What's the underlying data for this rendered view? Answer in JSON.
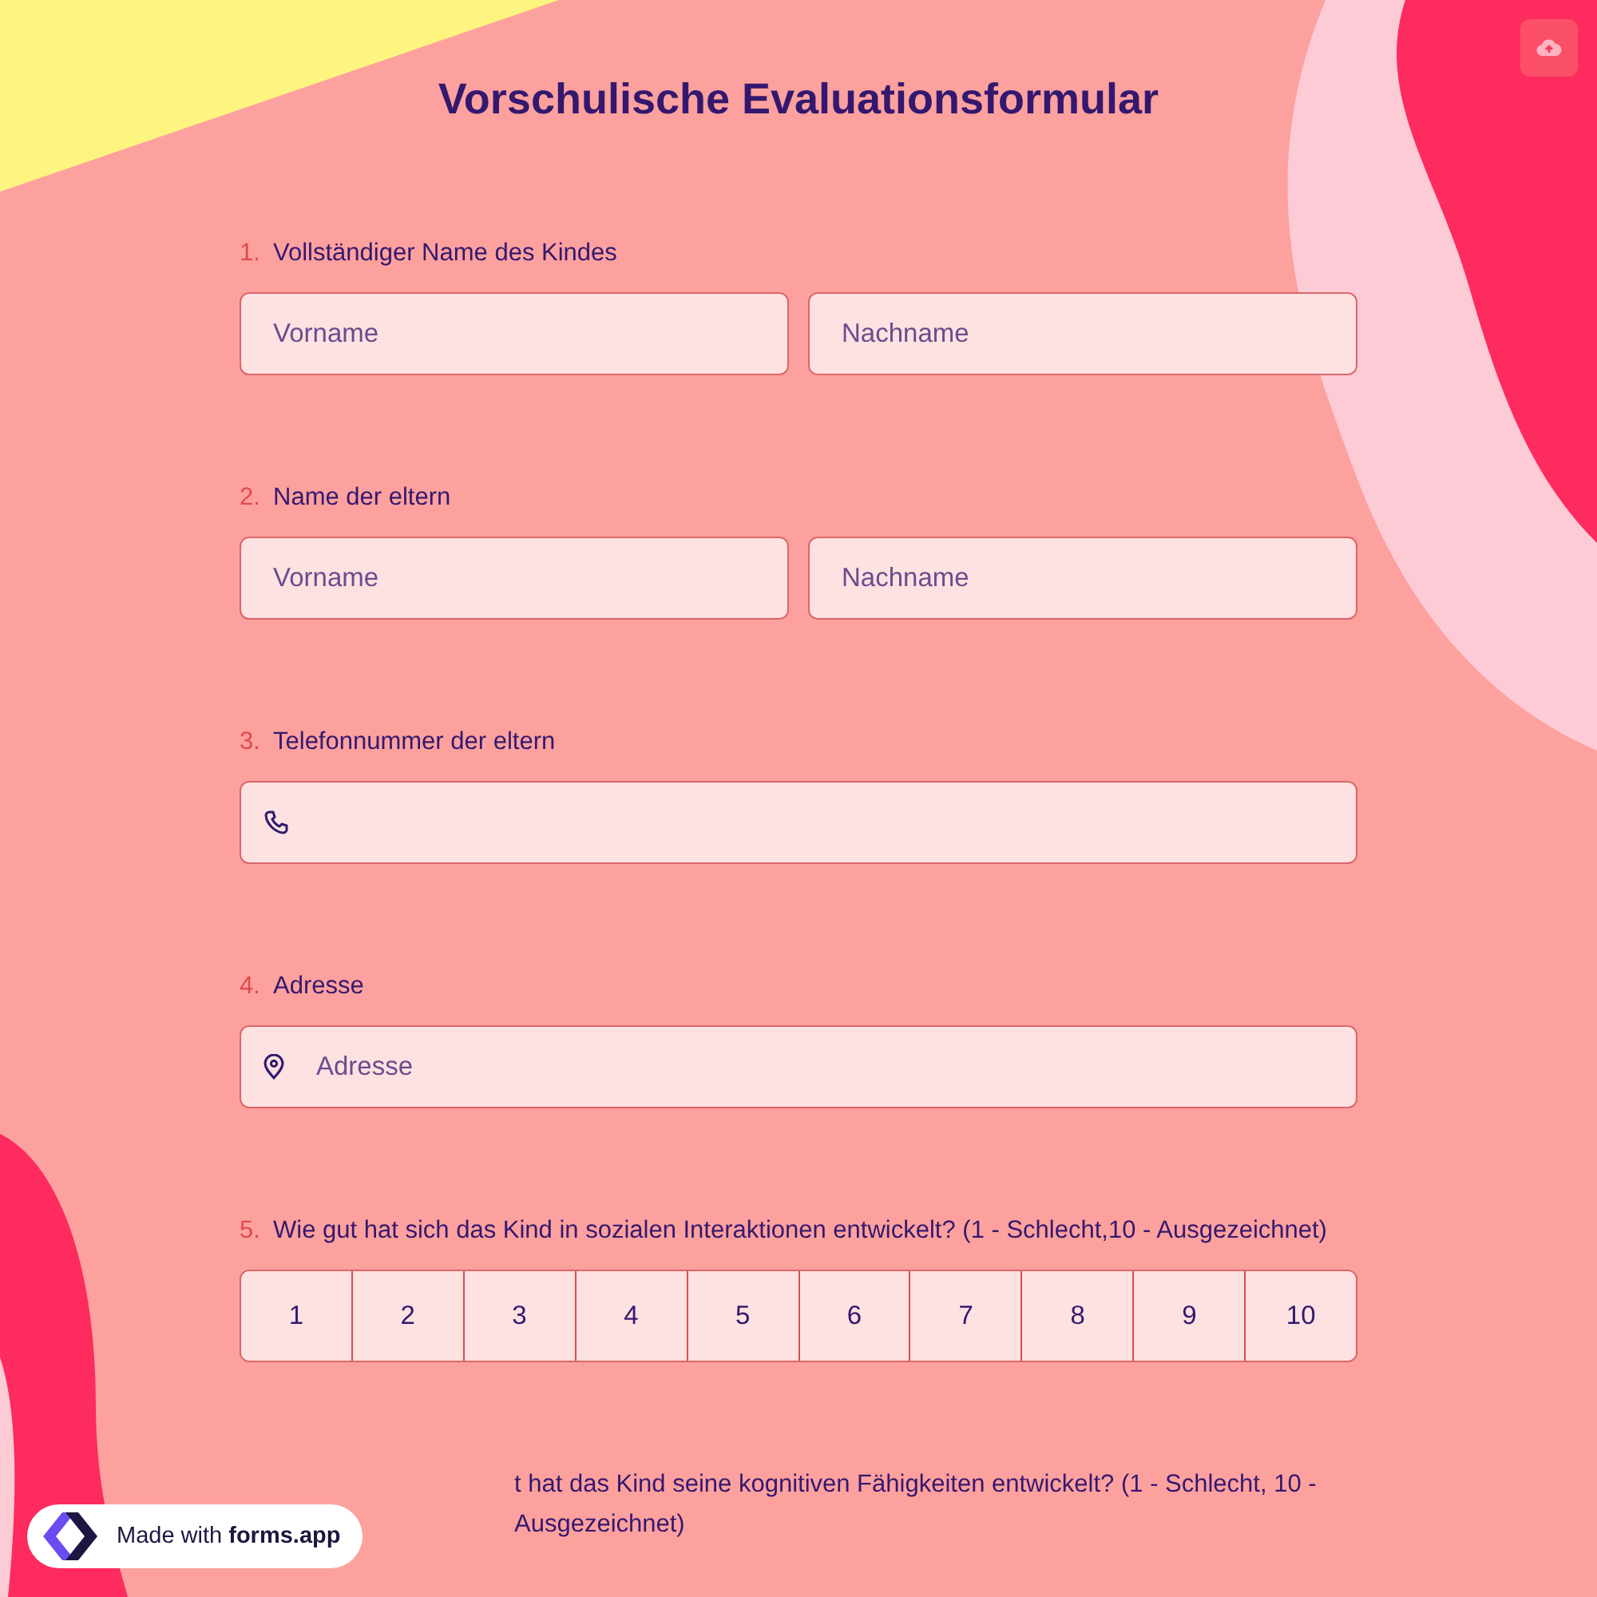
{
  "title": "Vorschulische Evaluationsformular",
  "questions": [
    {
      "number": "1.",
      "label": "Vollständiger Name des Kindes",
      "kind": "split",
      "fields": [
        {
          "placeholder": "Vorname"
        },
        {
          "placeholder": "Nachname"
        }
      ]
    },
    {
      "number": "2.",
      "label": "Name der eltern",
      "kind": "split",
      "fields": [
        {
          "placeholder": "Vorname"
        },
        {
          "placeholder": "Nachname"
        }
      ]
    },
    {
      "number": "3.",
      "label": "Telefonnummer der eltern",
      "kind": "phone"
    },
    {
      "number": "4.",
      "label": "Adresse",
      "kind": "address",
      "placeholder": "Adresse"
    },
    {
      "number": "5.",
      "label": "Wie gut hat sich das Kind in sozialen Interaktionen entwickelt? (1 - Schlecht,10 - Ausgezeichnet)",
      "kind": "rating",
      "options": [
        {
          "label": "1",
          "selected": false
        },
        {
          "label": "2",
          "selected": false
        },
        {
          "label": "3",
          "selected": false
        },
        {
          "label": "4",
          "selected": false
        },
        {
          "label": "5",
          "selected": false
        },
        {
          "label": "6",
          "selected": false
        },
        {
          "label": "7",
          "selected": false
        },
        {
          "label": "8",
          "selected": false
        },
        {
          "label": "9",
          "selected": false
        },
        {
          "label": "10",
          "selected": false
        }
      ]
    },
    {
      "label": "t hat das Kind seine kognitiven Fähigkeiten entwickelt? (1 - Schlecht, 10 - Ausgezeichnet)",
      "kind": "partial"
    }
  ],
  "badge": {
    "text": "Made with **forms.app**"
  }
}
